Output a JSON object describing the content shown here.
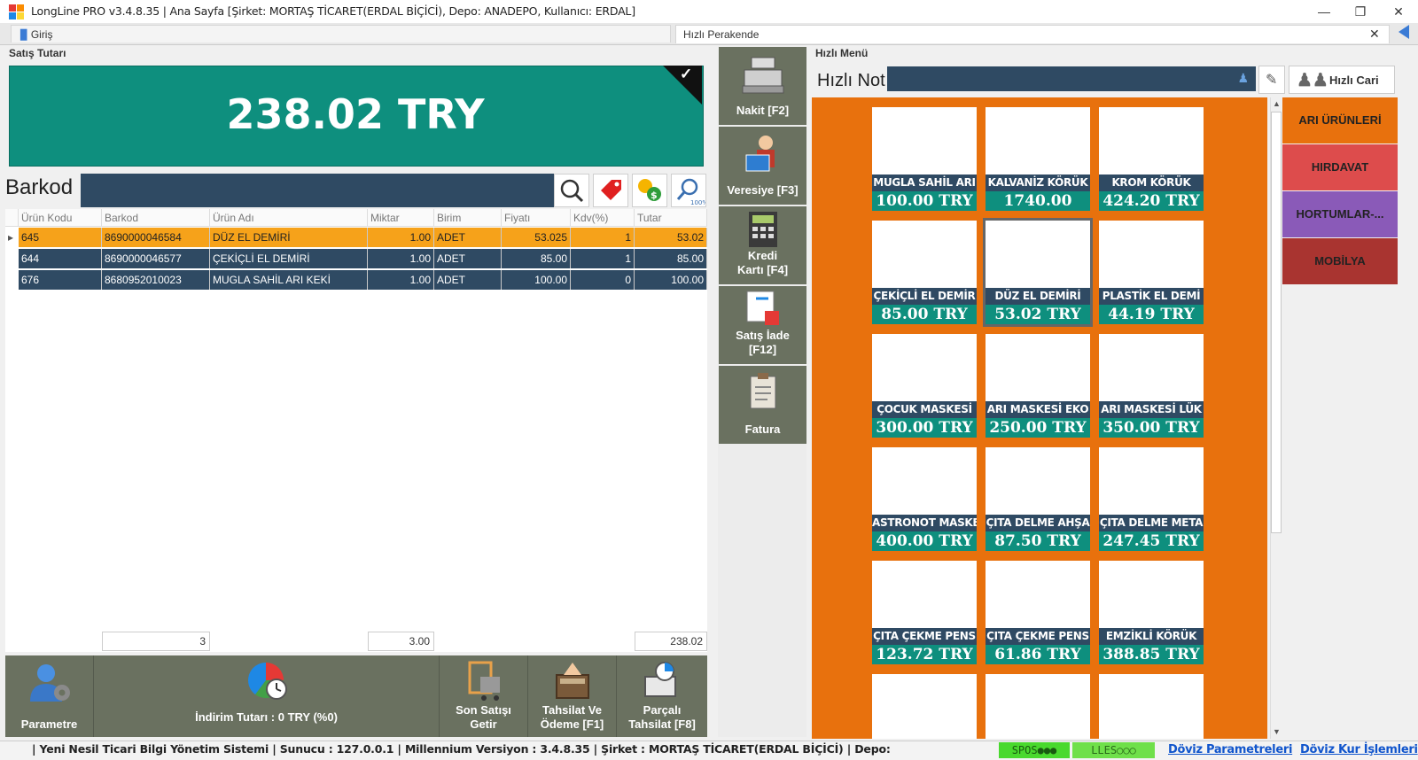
{
  "window": {
    "title": "LongLine PRO v3.4.8.35 | Ana Sayfa [Şirket: MORTAŞ TİCARET(ERDAL BİÇİCİ), Depo: ANADEPO, Kullanıcı: ERDAL]"
  },
  "tabs": [
    {
      "label": "Giriş"
    },
    {
      "label": "Hızlı Perakende"
    }
  ],
  "left": {
    "section_title": "Satış Tutarı",
    "total": "238.02 TRY",
    "barkod_label": "Barkod",
    "table": {
      "columns": [
        "Ürün Kodu",
        "Barkod",
        "Ürün Adı",
        "Miktar",
        "Birim",
        "Fiyatı",
        "Kdv(%)",
        "Tutar"
      ],
      "rows": [
        {
          "kod": "645",
          "barkod": "8690000046584",
          "ad": "DÜZ EL DEMİRİ",
          "miktar": "1.00",
          "birim": "ADET",
          "fiyat": "53.025",
          "kdv": "1",
          "tutar": "53.02"
        },
        {
          "kod": "644",
          "barkod": "8690000046577",
          "ad": "ÇEKİÇLİ EL DEMİRİ",
          "miktar": "1.00",
          "birim": "ADET",
          "fiyat": "85.00",
          "kdv": "1",
          "tutar": "85.00"
        },
        {
          "kod": "676",
          "barkod": "8680952010023",
          "ad": "MUGLA SAHİL ARI KEKİ",
          "miktar": "1.00",
          "birim": "ADET",
          "fiyat": "100.00",
          "kdv": "0",
          "tutar": "100.00"
        }
      ],
      "footer": {
        "count": "3",
        "miktar": "3.00",
        "tutar": "238.02"
      }
    },
    "actions": {
      "parametre": "Parametre",
      "indirim": "İndirim Tutarı : 0 TRY (%0)",
      "son_satis": [
        "Son Satışı",
        "Getir"
      ],
      "tahsilat": [
        "Tahsilat Ve",
        "Ödeme [F1]"
      ],
      "parcali": [
        "Parçalı",
        "Tahsilat [F8]"
      ]
    }
  },
  "middle": {
    "buttons": [
      {
        "lines": [
          "Nakit [F2]"
        ]
      },
      {
        "lines": [
          "Veresiye [F3]"
        ]
      },
      {
        "lines": [
          "Kredi",
          "Kartı [F4]"
        ]
      },
      {
        "lines": [
          "Satış İade",
          "[F12]"
        ]
      },
      {
        "lines": [
          "Fatura"
        ]
      }
    ]
  },
  "menu": {
    "title": "Hızlı Menü",
    "not_label": "Hızlı Not",
    "cari_label": "Hızlı Cari",
    "products": [
      {
        "name": "MUGLA SAHİL ARI",
        "price": "100.00 TRY"
      },
      {
        "name": "KALVANİZ KÖRÜK",
        "price": "1740.00 TRY"
      },
      {
        "name": "KROM KÖRÜK",
        "price": "424.20 TRY"
      },
      {
        "name": "ÇEKİÇLİ EL DEMİR",
        "price": "85.00 TRY"
      },
      {
        "name": "DÜZ EL DEMİRİ",
        "price": "53.02 TRY"
      },
      {
        "name": "PLASTİK EL DEMİ",
        "price": "44.19 TRY"
      },
      {
        "name": "ÇOCUK MASKESİ",
        "price": "300.00 TRY"
      },
      {
        "name": "ARI MASKESİ EKO",
        "price": "250.00 TRY"
      },
      {
        "name": "ARI MASKESİ LÜK",
        "price": "350.00 TRY"
      },
      {
        "name": "ASTRONOT MASKE",
        "price": "400.00 TRY"
      },
      {
        "name": "ÇITA DELME AHŞA",
        "price": "87.50 TRY"
      },
      {
        "name": "ÇITA DELME META",
        "price": "247.45 TRY"
      },
      {
        "name": "ÇITA ÇEKME PENS",
        "price": "123.72 TRY"
      },
      {
        "name": "ÇITA ÇEKME PENS",
        "price": "61.86 TRY"
      },
      {
        "name": "EMZİKLİ KÖRÜK",
        "price": "388.85 TRY"
      }
    ],
    "categories": [
      {
        "label": "ARI ÜRÜNLERİ",
        "color": "#e8710d"
      },
      {
        "label": "HIRDAVAT",
        "color": "#dd4c4c"
      },
      {
        "label": "HORTUMLAR-...",
        "color": "#8a5ab8"
      },
      {
        "label": "MOBİLYA",
        "color": "#a93430"
      }
    ]
  },
  "status": {
    "text": "|   Yeni Nesil Ticari Bilgi Yönetim Sistemi   |   Sunucu :  127.0.0.1   |   Millennium Versiyon :  3.4.8.35   |   Şirket :  MORTAŞ TİCARET(ERDAL BİÇİCİ)   |   Depo:",
    "spos": "SPOS●●●",
    "lles": "LLES○○○",
    "link1": "Döviz Parametreleri",
    "link2": "Döviz Kur İşlemleri"
  }
}
